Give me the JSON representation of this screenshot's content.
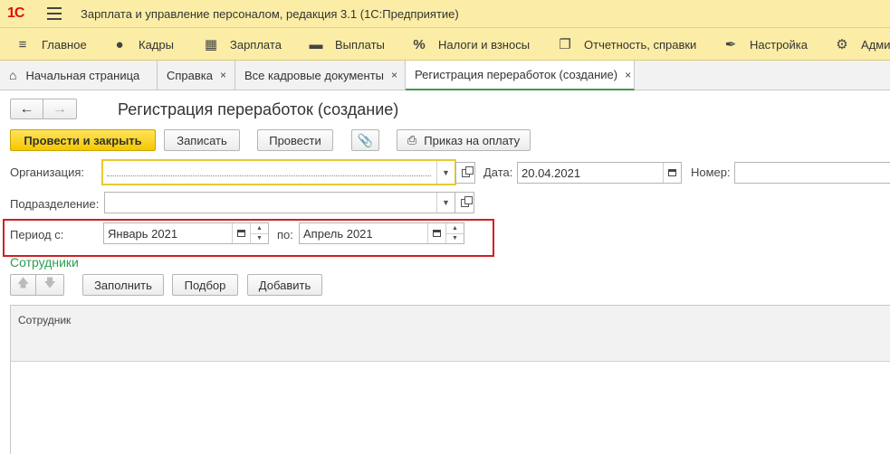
{
  "titlebar": {
    "logo": "1С",
    "app_title": "Зарплата и управление персоналом, редакция 3.1  (1С:Предприятие)"
  },
  "sections": [
    {
      "label": "Главное",
      "icon": "hamburger-icon"
    },
    {
      "label": "Кадры",
      "icon": "people-icon"
    },
    {
      "label": "Зарплата",
      "icon": "calculator-icon"
    },
    {
      "label": "Выплаты",
      "icon": "wallet-icon"
    },
    {
      "label": "Налоги и взносы",
      "icon": "percent-icon"
    },
    {
      "label": "Отчетность, справки",
      "icon": "reports-icon"
    },
    {
      "label": "Настройка",
      "icon": "wrench-icon"
    },
    {
      "label": "Адми",
      "icon": "gear-icon"
    }
  ],
  "tabs": [
    {
      "label": "Начальная страница",
      "icon": "home-icon"
    },
    {
      "label": "Справка",
      "close": "×"
    },
    {
      "label": "Все кадровые документы",
      "close": "×"
    },
    {
      "label": "Регистрация переработок (создание)",
      "close": "×"
    }
  ],
  "form": {
    "title": "Регистрация переработок (создание)",
    "buttons": {
      "post_close": "Провести и закрыть",
      "save": "Записать",
      "post": "Провести",
      "print_order": "Приказ на оплату"
    },
    "organization": {
      "label": "Организация:",
      "value": ""
    },
    "date": {
      "label": "Дата:",
      "value": "20.04.2021"
    },
    "number": {
      "label": "Номер:",
      "value": ""
    },
    "department": {
      "label": "Подразделение:",
      "value": ""
    },
    "period": {
      "from_label": "Период с:",
      "from_value": "Январь 2021",
      "to_label": "по:",
      "to_value": "Апрель 2021"
    },
    "employees": {
      "title": "Сотрудники",
      "fill": "Заполнить",
      "select": "Подбор",
      "add": "Добавить",
      "column": "Сотрудник"
    }
  },
  "colors": {
    "header_bg": "#fbeda6",
    "primary_button": "#f5c800",
    "accent_green": "#2e9e4f",
    "highlight_red": "#d02020"
  }
}
